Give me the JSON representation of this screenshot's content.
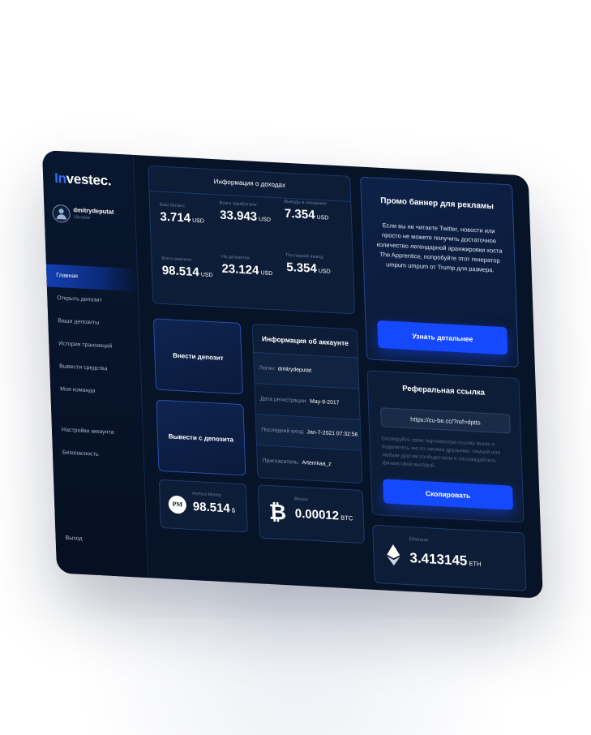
{
  "brand": {
    "prefix": "In",
    "suffix": "vestec."
  },
  "user": {
    "name": "dmitrydeputat",
    "country": "Ukraine"
  },
  "sidebar": {
    "items": [
      {
        "label": "Главная",
        "active": true
      },
      {
        "label": "Открыть депозит"
      },
      {
        "label": "Ваши депозиты"
      },
      {
        "label": "История транзакций"
      },
      {
        "label": "Вывести средства"
      },
      {
        "label": "Моя команда"
      }
    ],
    "settings": [
      {
        "label": "Настройки аккаунта"
      },
      {
        "label": "Безопасность"
      }
    ],
    "logout": "Выход"
  },
  "income": {
    "title": "Информация о доходах",
    "stats": [
      {
        "label": "Ваш баланс:",
        "value": "3.714",
        "unit": "USD"
      },
      {
        "label": "Всего заработали:",
        "value": "33.943",
        "unit": "USD"
      },
      {
        "label": "Выводы в ожидании:",
        "value": "7.354",
        "unit": "USD"
      },
      {
        "label": "Всего внесено:",
        "value": "98.514",
        "unit": "USD"
      },
      {
        "label": "На депозитах:",
        "value": "23.124",
        "unit": "USD"
      },
      {
        "label": "Последний вывод:",
        "value": "5.354",
        "unit": "USD"
      }
    ]
  },
  "promo": {
    "title": "Промо баннер для рекламы",
    "text": "Если вы не читаете Twitter, новости или просто не можете получить достаточное количество легендарной аранжировки хоста The Apprentice, попробуйте этот генератор umpum umpum от Trump для размера.",
    "button": "Узнать детальнее"
  },
  "actions": {
    "deposit": "Внести депозит",
    "withdraw": "Вывести с депозита"
  },
  "account": {
    "title": "Информация об аккаунте",
    "rows": [
      {
        "key": "Логин:",
        "value": "dmitrydeputat"
      },
      {
        "key": "Дата регистрации:",
        "value": "May-9-2017"
      },
      {
        "key": "Последний вход:",
        "value": "Jan-7-2021 07:32:56"
      },
      {
        "key": "Пригласитель:",
        "value": "Artemkaa_z"
      }
    ]
  },
  "referral": {
    "title": "Реферальная ссылка",
    "link": "https://cu-be.cc/?ref=dptts",
    "note": "Скопируйте свою партнерскую ссылку выше и поделитесь ею со своими друзьями, семьей или любым другим сообществом и наслаждайтесь финансовой выгодой.",
    "button": "Скопировать"
  },
  "wallets": {
    "pm": {
      "icon": "PM",
      "name": "Perfect Money",
      "value": "98.514",
      "unit": "$"
    },
    "btc": {
      "name": "Bitcoin",
      "value": "0.00012",
      "unit": "BTC"
    },
    "eth": {
      "name": "Ethereum",
      "value": "3.413145",
      "unit": "ETH"
    }
  },
  "colors": {
    "background": "#071326",
    "panel": "#0d1d37",
    "accent": "#1449ff",
    "brand_accent": "#2e6bff"
  }
}
